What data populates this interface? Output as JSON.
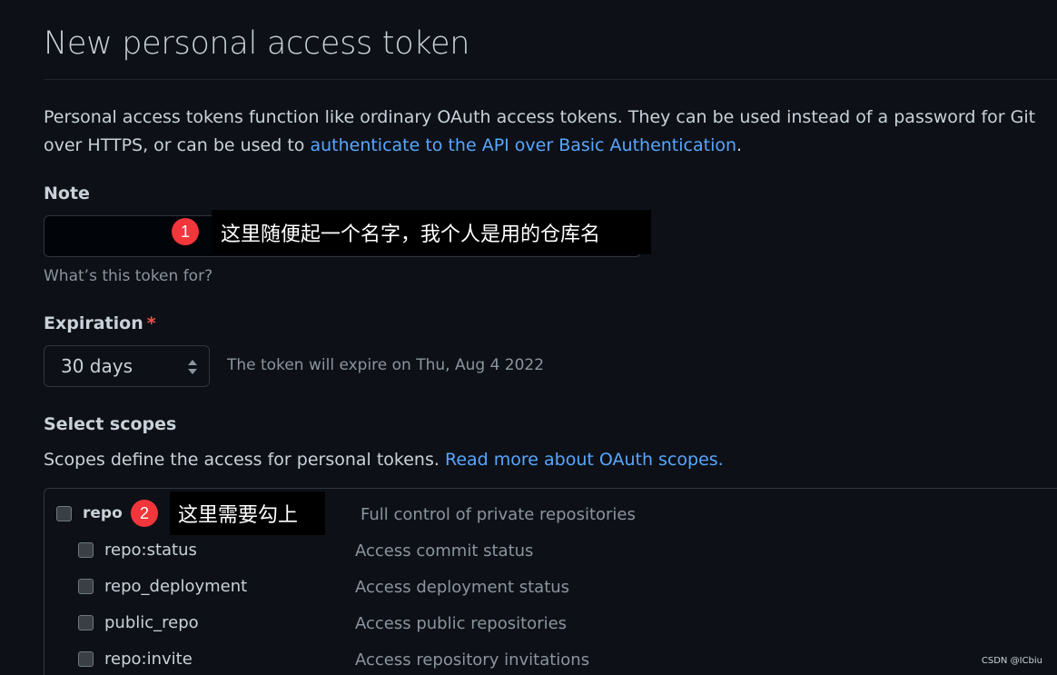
{
  "header": {
    "title": "New personal access token",
    "intro_text": "Personal access tokens function like ordinary OAuth access tokens. They can be used instead of a password for Git over HTTPS, or can be used to ",
    "intro_link": "authenticate to the API over Basic Authentication",
    "intro_end": "."
  },
  "note": {
    "label": "Note",
    "value": "",
    "hint": "What’s this token for?"
  },
  "expiration": {
    "label": "Expiration",
    "required_mark": "*",
    "selected": "30 days",
    "info": "The token will expire on Thu, Aug 4 2022"
  },
  "scopes": {
    "heading": "Select scopes",
    "desc": "Scopes define the access for personal tokens. ",
    "link": "Read more about OAuth scopes.",
    "items": [
      {
        "name": "repo",
        "desc": "Full control of private repositories"
      },
      {
        "name": "repo:status",
        "desc": "Access commit status"
      },
      {
        "name": "repo_deployment",
        "desc": "Access deployment status"
      },
      {
        "name": "public_repo",
        "desc": "Access public repositories"
      },
      {
        "name": "repo:invite",
        "desc": "Access repository invitations"
      }
    ]
  },
  "annotations": {
    "one": {
      "number": "1",
      "text": "这里随便起一个名字，我个人是用的仓库名"
    },
    "two": {
      "number": "2",
      "text": "这里需要勾上"
    }
  },
  "watermark": "CSDN @ICbiu",
  "colors": {
    "background": "#0d1117",
    "link": "#58a6ff",
    "badge": "#f2363c"
  }
}
